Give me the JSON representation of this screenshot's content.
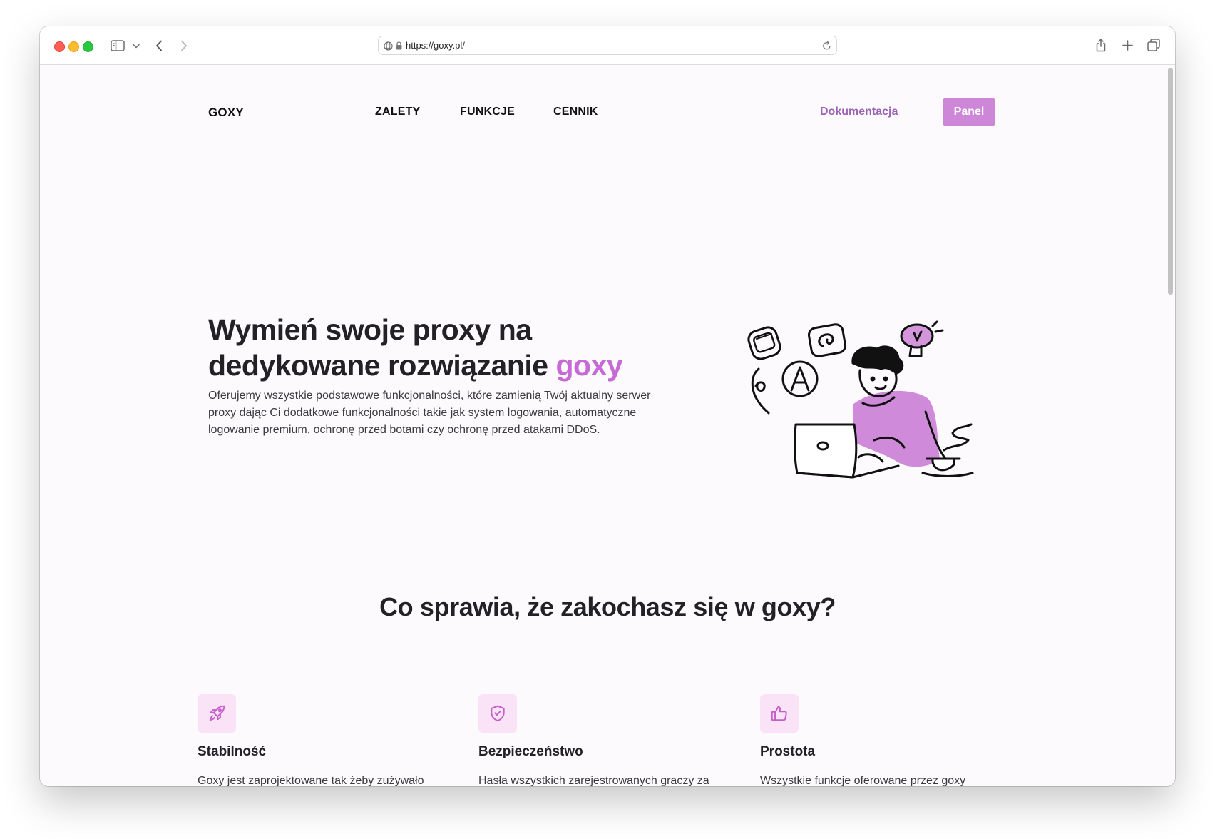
{
  "browser": {
    "url": "https://goxy.pl/",
    "icons": [
      "sidebar-icon",
      "chevron-down-icon",
      "back-icon",
      "forward-icon",
      "globe-icon",
      "lock-icon",
      "reload-icon",
      "share-icon",
      "new-tab-icon",
      "tabs-overview-icon"
    ]
  },
  "nav": {
    "logo": "GOXY",
    "links": [
      "ZALETY",
      "FUNKCJE",
      "CENNIK"
    ],
    "docs_label": "Dokumentacja",
    "panel_label": "Panel"
  },
  "hero": {
    "title_part1": "Wymień swoje proxy na dedykowane rozwiązanie ",
    "title_accent": "goxy",
    "subtitle": "Oferujemy wszystkie podstawowe funkcjonalności, które zamienią Twój aktualny serwer proxy dając Ci dodatkowe funkcjonalności takie jak system logowania, automatyczne logowanie premium, ochronę przed botami czy ochronę przed atakami DDoS."
  },
  "features_section": {
    "title": "Co sprawia, że zakochasz się w goxy?",
    "items": [
      {
        "icon": "rocket-icon",
        "title": "Stabilność",
        "text": "Goxy jest zaprojektowane tak żeby zużywało"
      },
      {
        "icon": "shield-icon",
        "title": "Bezpieczeństwo",
        "text": "Hasła wszystkich zarejestrowanych graczy za"
      },
      {
        "icon": "thumbs-up-icon",
        "title": "Prostota",
        "text": "Wszystkie funkcje oferowane przez goxy"
      }
    ]
  },
  "colors": {
    "accent": "#c66ad6",
    "button": "#cd86d8",
    "docs_link": "#9b63b3",
    "icon_bg": "#fbe3f7",
    "icon_stroke": "#c45fc9"
  }
}
